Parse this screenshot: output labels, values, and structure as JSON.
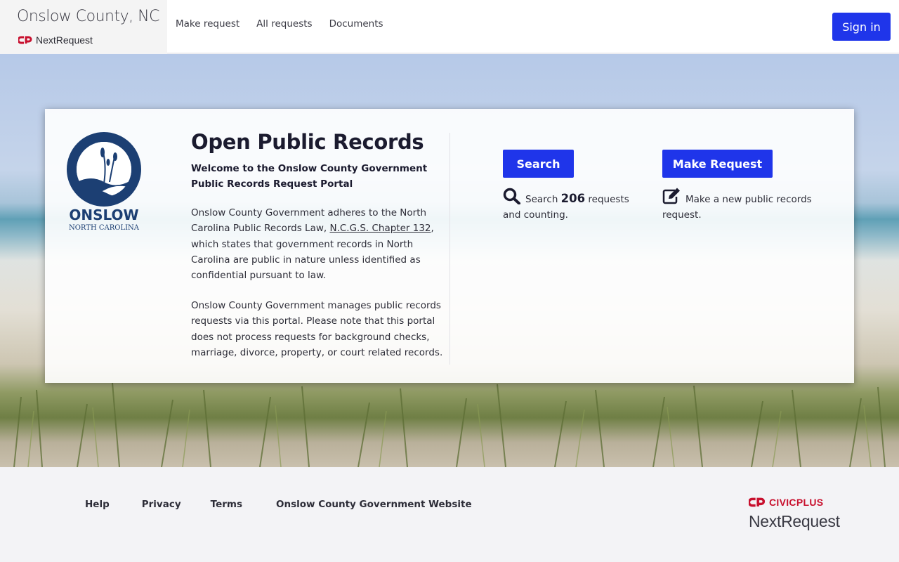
{
  "header": {
    "org_title": "Onslow County, NC",
    "product_name": "NextRequest",
    "nav": [
      {
        "label": "Make request"
      },
      {
        "label": "All requests"
      },
      {
        "label": "Documents"
      }
    ],
    "sign_in_label": "Sign in"
  },
  "card": {
    "logo_text": "ONSLOW",
    "logo_subtext": "NORTH CAROLINA",
    "title": "Open Public Records",
    "subtitle": "Welcome to the Onslow County Government Public Records Request Portal",
    "para1_before": "Onslow County Government adheres to the North Carolina Public Records Law, ",
    "para1_link": "N.C.G.S. Chapter 132",
    "para1_after": ", which states that government records in North Carolina are public in nature unless identified as confidential pursuant to law.",
    "para2": "Onslow County Government manages public records requests via this portal. Please note that this portal does not process requests for background checks, marriage, divorce, property, or court related records.",
    "search_button": "Search",
    "search_prefix": "Search ",
    "search_count": "206",
    "search_suffix": " requests and counting.",
    "make_button": "Make Request",
    "make_desc": "Make a new public records request."
  },
  "footer": {
    "links": [
      {
        "label": "Help"
      },
      {
        "label": "Privacy"
      },
      {
        "label": "Terms"
      },
      {
        "label": "Onslow County Government Website"
      }
    ],
    "civicplus": "CIVICPLUS",
    "nextrequest": "NextRequest"
  },
  "colors": {
    "accent": "#1f35ea",
    "civicplus_red": "#c8102e",
    "logo_navy": "#1c3f73"
  }
}
